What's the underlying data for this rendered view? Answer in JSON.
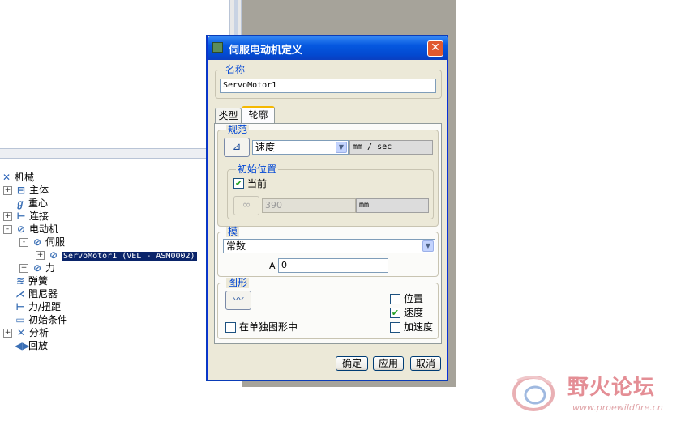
{
  "tree": {
    "root": "机械",
    "items": [
      {
        "label": "主体",
        "expand": "+"
      },
      {
        "label": "重心",
        "expand": ""
      },
      {
        "label": "连接",
        "expand": "+"
      },
      {
        "label": "电动机",
        "expand": "-"
      },
      {
        "label": "伺服",
        "expand": "-"
      },
      {
        "label": "ServoMotor1 (VEL - ASM0002)",
        "expand": "+"
      },
      {
        "label": "力",
        "expand": "+"
      },
      {
        "label": "弹簧",
        "expand": ""
      },
      {
        "label": "阻尼器",
        "expand": ""
      },
      {
        "label": "力/扭距",
        "expand": ""
      },
      {
        "label": "初始条件",
        "expand": ""
      },
      {
        "label": "分析",
        "expand": "+"
      },
      {
        "label": "回放",
        "expand": ""
      }
    ]
  },
  "dialog": {
    "title": "伺服电动机定义",
    "close": "✕",
    "name_legend": "名称",
    "name_value": "ServoMotor1",
    "tabs": [
      "类型",
      "轮廓"
    ],
    "active_tab": "轮廓",
    "spec": {
      "legend": "规范",
      "select_value": "速度",
      "unit": "mm / sec"
    },
    "initial": {
      "legend": "初始位置",
      "current_label": "当前",
      "current_checked": true,
      "value": "390",
      "unit": "mm"
    },
    "magnitude": {
      "legend": "模",
      "select_value": "常数",
      "a_label": "A",
      "a_value": "0"
    },
    "graph": {
      "legend": "图形",
      "separate_label": "在单独图形中",
      "position_label": "位置",
      "velocity_label": "速度",
      "accel_label": "加速度",
      "position_checked": false,
      "velocity_checked": true,
      "accel_checked": false
    },
    "buttons": {
      "ok": "确定",
      "apply": "应用",
      "cancel": "取消"
    }
  },
  "watermark": {
    "text": "野火论坛",
    "url": "www.proewildfire.cn"
  }
}
